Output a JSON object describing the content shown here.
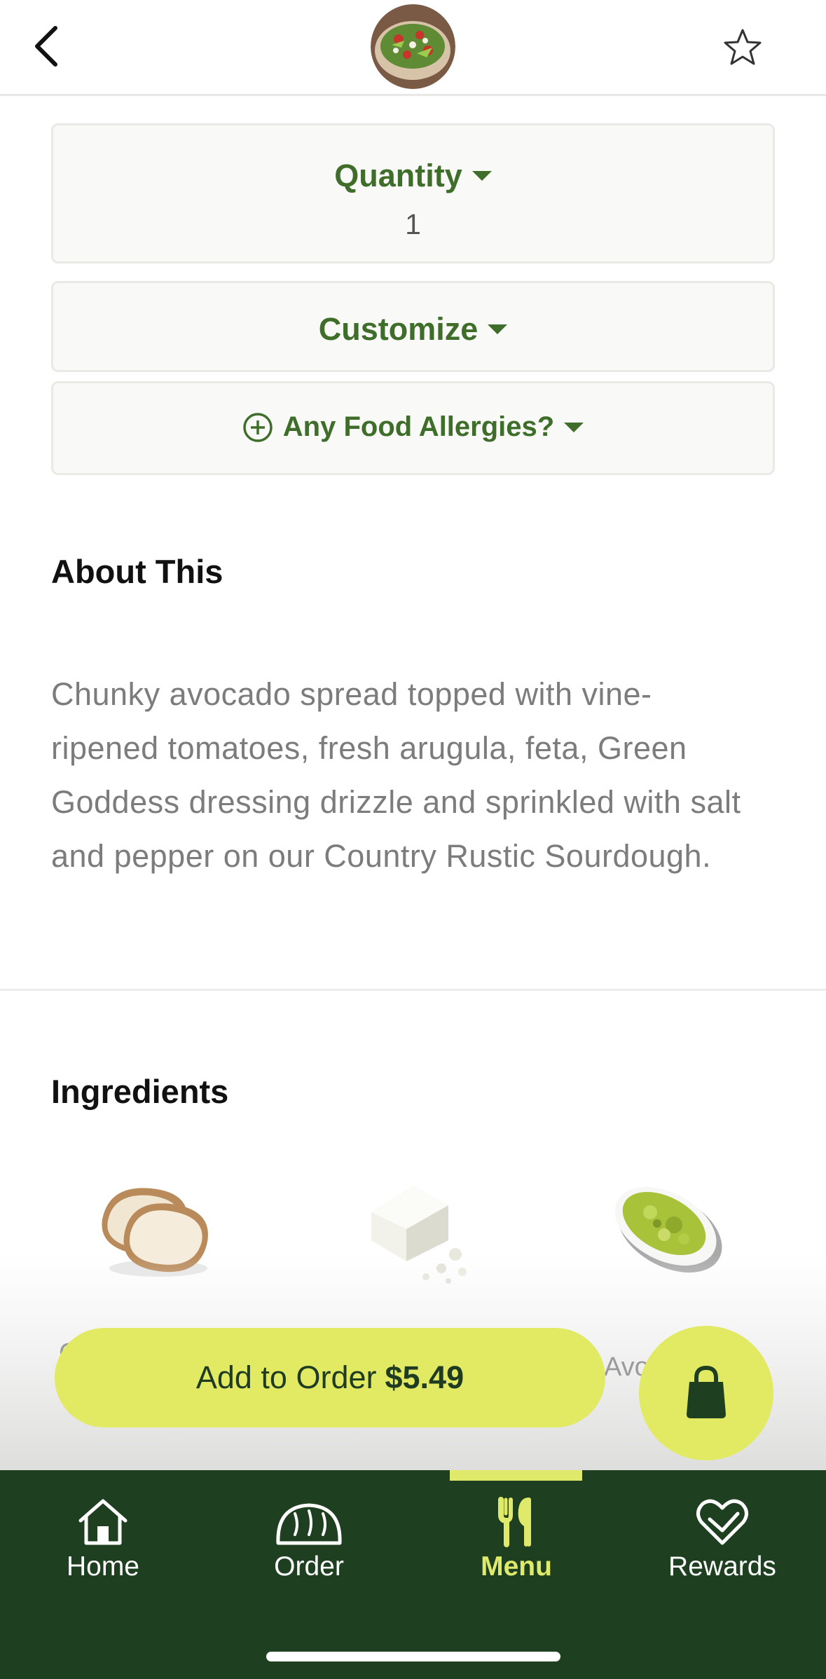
{
  "header": {
    "back_icon": "chevron-left-icon",
    "thumbnail": "avocado-toast-thumbnail",
    "favorite_icon": "star-icon"
  },
  "options": {
    "quantity_label": "Quantity",
    "quantity_value": "1",
    "customize_label": "Customize",
    "allergies_label": "Any Food Allergies?"
  },
  "about": {
    "title": "About This",
    "description": "Chunky avocado spread topped with vine-ripened tomatoes, fresh arugula, feta, Green Goddess dressing drizzle and sprinkled with salt and pepper on our Country Rustic Sourdough."
  },
  "ingredients": {
    "title": "Ingredients",
    "peek_left": "C",
    "peek_right": "Avo",
    "items": [
      {
        "icon": "sourdough-bread-icon"
      },
      {
        "icon": "feta-cheese-icon"
      },
      {
        "icon": "avocado-spread-icon"
      }
    ]
  },
  "cta": {
    "add_label": "Add to Order",
    "price": "$5.49",
    "bag_icon": "shopping-bag-icon"
  },
  "nav": {
    "items": [
      {
        "label": "Home",
        "icon": "home-icon"
      },
      {
        "label": "Order",
        "icon": "bread-icon"
      },
      {
        "label": "Menu",
        "icon": "fork-knife-icon",
        "active": true
      },
      {
        "label": "Rewards",
        "icon": "heart-icon"
      }
    ]
  },
  "colors": {
    "brand_green": "#1e4020",
    "accent_lime": "#e1ea62",
    "option_text": "#3f6d2a"
  }
}
